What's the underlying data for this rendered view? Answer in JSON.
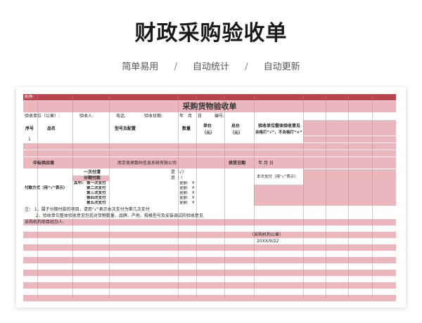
{
  "hero": {
    "title": "财政采购验收单",
    "tags": [
      "简单易用",
      "自动统计",
      "自动更新"
    ],
    "separator": "/"
  },
  "sheet": {
    "attachment": "附件:",
    "title": "采购货物验收单",
    "info_row": {
      "unit": "验收单位（公章）:",
      "receiver": "验收人:",
      "phone": "电话:",
      "date_label": "验收日期:",
      "year": "年",
      "month": "月",
      "day": "日",
      "serial": "编号:"
    },
    "headers": {
      "no": "序号",
      "name": "品名",
      "model": "型号及配置",
      "qty": "数量",
      "unit_price": "单价",
      "unit_price_unit": "（元）",
      "total": "总价",
      "total_unit": "（元）",
      "opinion": "验收单位整体验收意见",
      "opinion_hint": "合格打“√”，不合格打“×”"
    },
    "row1_no": "1",
    "supplier_label": "中标供应商",
    "supplier_name": "南京美承数码信息系统有限公司",
    "supply_date_label": "供货日期",
    "supply_date_value": "年    月    日",
    "payment": {
      "label": "付款方式（用“√”表示）",
      "one_time": "一次付清",
      "installment": "分期付款",
      "of_which": "其中:",
      "installments": [
        "第一次支付",
        "第二次支付",
        "第三次支付",
        "第四次支付",
        "第五次支付"
      ],
      "yes_checked": "是（√）",
      "yes_empty": "是（    ）",
      "amount": "金额:",
      "yen": "¥",
      "this_time": "本次支付（用“√”表示）"
    },
    "notes": [
      "注：  1、属于分期付款的项目，请用“√”表示本次支付为第几次支付",
      "2、验收单位整体验收意见包括对货物数量、品牌、产地、规格型号及安装调试的验收意见"
    ],
    "agent": "采购机构项目经办人:",
    "stamp": "（采购机构公章）",
    "stamp_date": "20XX/9/22"
  }
}
